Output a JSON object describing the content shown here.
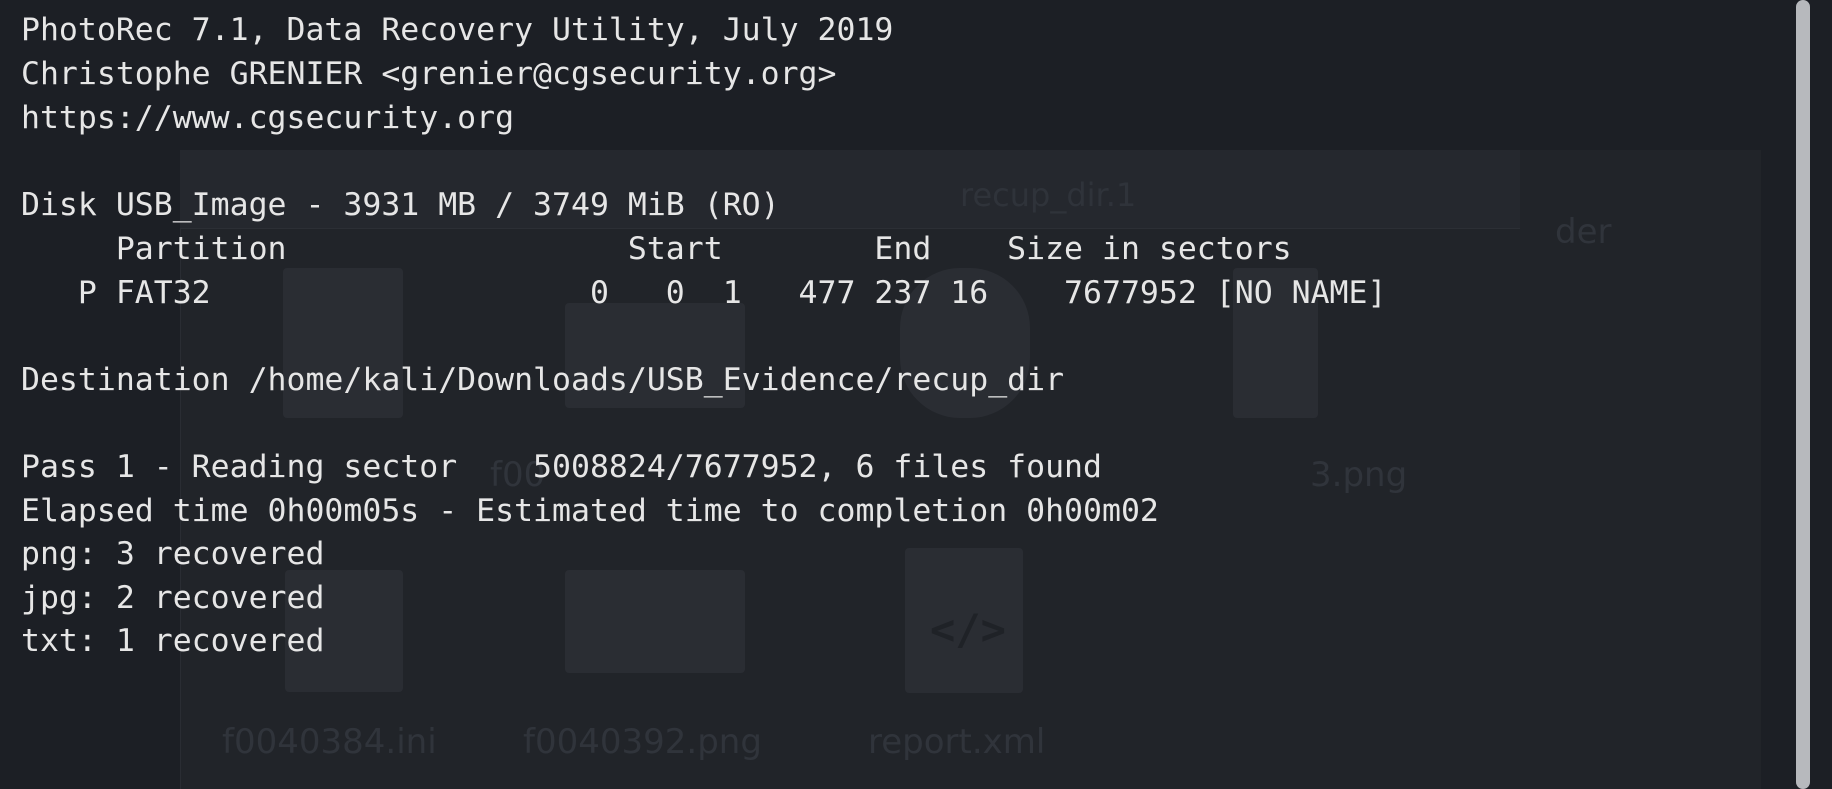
{
  "terminal": {
    "header": {
      "title": "PhotoRec 7.1, Data Recovery Utility, July 2019",
      "author": "Christophe GRENIER <grenier@cgsecurity.org>",
      "url": "https://www.cgsecurity.org"
    },
    "disk": {
      "line": "Disk USB_Image - 3931 MB / 3749 MiB (RO)",
      "columns_line": "     Partition                  Start        End    Size in sectors",
      "partition_line": "   P FAT32                    0   0  1   477 237 16    7677952 [NO NAME]"
    },
    "destination": "Destination /home/kali/Downloads/USB_Evidence/recup_dir",
    "progress": {
      "pass_line": "Pass 1 - Reading sector    5008824/7677952, 6 files found",
      "elapsed_line": "Elapsed time 0h00m05s - Estimated time to completion 0h00m02"
    },
    "recovered": [
      "png: 3 recovered",
      "jpg: 2 recovered",
      "txt: 1 recovered"
    ]
  },
  "background_window": {
    "tab_label": "recup_dir.1",
    "files": [
      "f0040384.ini",
      "f0040392.png",
      "report.xml"
    ],
    "partial_labels": [
      "f00",
      "3.png",
      "der"
    ]
  },
  "colors": {
    "terminal_bg": "#1c1f25",
    "terminal_fg": "#e6e6e6",
    "scrollbar": "#b7b9bd"
  }
}
